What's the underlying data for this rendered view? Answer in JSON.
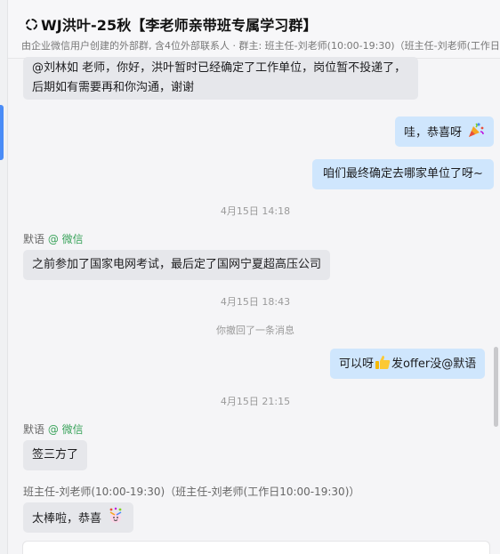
{
  "header": {
    "title": "WJ洪叶-25秋【李老师亲带班专属学习群】",
    "subtitle": "由企业微信用户创建的外部群, 含4位外部联系人 · 群主: 班主任-刘老师(10:00-19:30)（班主任-刘老师(工作日10"
  },
  "messages": {
    "m1": {
      "line1": "@刘林如 老师，你好，洪叶暂时已经确定了工作单位，岗位暂不投递了，",
      "line2": "后期如有需要再和你沟通，谢谢"
    },
    "m2": {
      "text": "哇，恭喜呀"
    },
    "m3": {
      "text": "咱们最终确定去哪家单位了呀~"
    },
    "t1": "4月15日 14:18",
    "s1": {
      "name": "默语",
      "platform": "@ 微信"
    },
    "m4": {
      "text": "之前参加了国家电网考试，最后定了国网宁夏超高压公司"
    },
    "t2": "4月15日 18:43",
    "recall": "你撤回了一条消息",
    "m5": {
      "text_a": "可以呀",
      "text_b": "发offer没@默语"
    },
    "t3": "4月15日 21:15",
    "s2": {
      "name": "默语",
      "platform": "@ 微信"
    },
    "m6": {
      "text": "签三方了"
    },
    "s3": {
      "name": "班主任-刘老师(10:00-19:30)（班主任-刘老师(工作日10:00-19:30)）"
    },
    "m7": {
      "text": "太棒啦，恭喜"
    }
  },
  "colors": {
    "incoming_bubble": "#e6e7eb",
    "outgoing_bubble": "#cfe6fd",
    "platform_green": "#3aa35b"
  },
  "icons": [
    "group-chat-icon",
    "party-popper-emoji",
    "thumbs-up-emoji",
    "celebration-emoji"
  ]
}
